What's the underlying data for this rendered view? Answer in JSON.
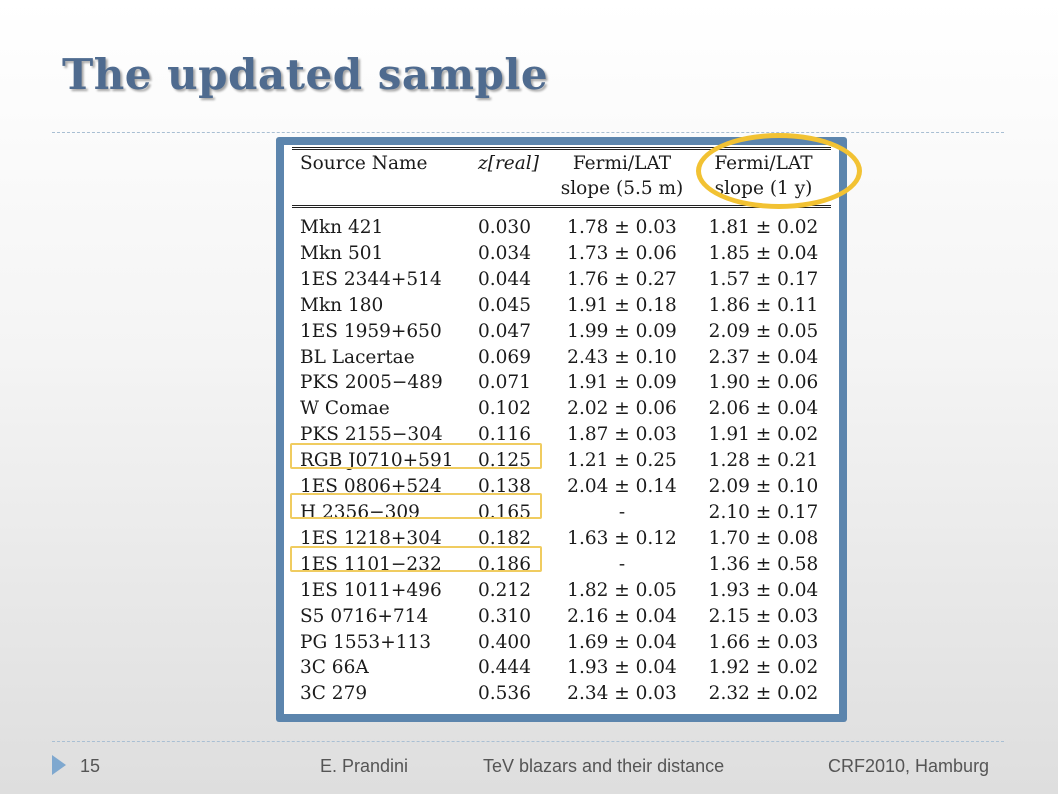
{
  "slide": {
    "title": "The updated sample"
  },
  "table": {
    "headers": {
      "name": "Source Name",
      "z": "z[real]",
      "s1_line1": "Fermi/LAT",
      "s1_line2": "slope (5.5 m)",
      "s2_line1": "Fermi/LAT",
      "s2_line2": "slope (1 y)"
    },
    "rows": [
      [
        "Mkn 421",
        "0.030",
        "1.78 ± 0.03",
        "1.81 ± 0.02"
      ],
      [
        "Mkn 501",
        "0.034",
        "1.73 ± 0.06",
        "1.85 ± 0.04"
      ],
      [
        "1ES 2344+514",
        "0.044",
        "1.76 ± 0.27",
        "1.57 ± 0.17"
      ],
      [
        "Mkn 180",
        "0.045",
        "1.91 ± 0.18",
        "1.86 ± 0.11"
      ],
      [
        "1ES 1959+650",
        "0.047",
        "1.99 ± 0.09",
        "2.09 ± 0.05"
      ],
      [
        "BL Lacertae",
        "0.069",
        "2.43 ± 0.10",
        "2.37 ± 0.04"
      ],
      [
        "PKS 2005−489",
        "0.071",
        "1.91 ± 0.09",
        "1.90 ± 0.06"
      ],
      [
        "W Comae",
        "0.102",
        "2.02 ± 0.06",
        "2.06 ± 0.04"
      ],
      [
        "PKS 2155−304",
        "0.116",
        "1.87 ± 0.03",
        "1.91 ± 0.02"
      ],
      [
        "RGB J0710+591",
        "0.125",
        "1.21 ± 0.25",
        "1.28 ± 0.21"
      ],
      [
        "1ES 0806+524",
        "0.138",
        "2.04 ± 0.14",
        "2.09 ± 0.10"
      ],
      [
        "H 2356−309",
        "0.165",
        "-",
        "2.10 ± 0.17"
      ],
      [
        "1ES 1218+304",
        "0.182",
        "1.63 ± 0.12",
        "1.70 ± 0.08"
      ],
      [
        "1ES 1101−232",
        "0.186",
        "-",
        "1.36 ± 0.58"
      ],
      [
        "1ES 1011+496",
        "0.212",
        "1.82 ± 0.05",
        "1.93 ± 0.04"
      ],
      [
        "S5 0716+714",
        "0.310",
        "2.16 ± 0.04",
        "2.15 ± 0.03"
      ],
      [
        "PG 1553+113",
        "0.400",
        "1.69 ± 0.04",
        "1.66 ± 0.03"
      ],
      [
        "3C 66A",
        "0.444",
        "1.93 ± 0.04",
        "1.92 ± 0.02"
      ],
      [
        "3C 279",
        "0.536",
        "2.34 ± 0.03",
        "2.32 ± 0.02"
      ]
    ],
    "highlighted_rows": [
      9,
      11,
      13
    ],
    "highlighted_column": "s2",
    "highlight_color": "#f2c233",
    "frame_color": "#5c85ad"
  },
  "footer": {
    "page": "15",
    "author": "E. Prandini",
    "topic": "TeV blazars and their distance",
    "conference": "CRF2010, Hamburg",
    "arrow_icon": "triangle-right-icon"
  }
}
